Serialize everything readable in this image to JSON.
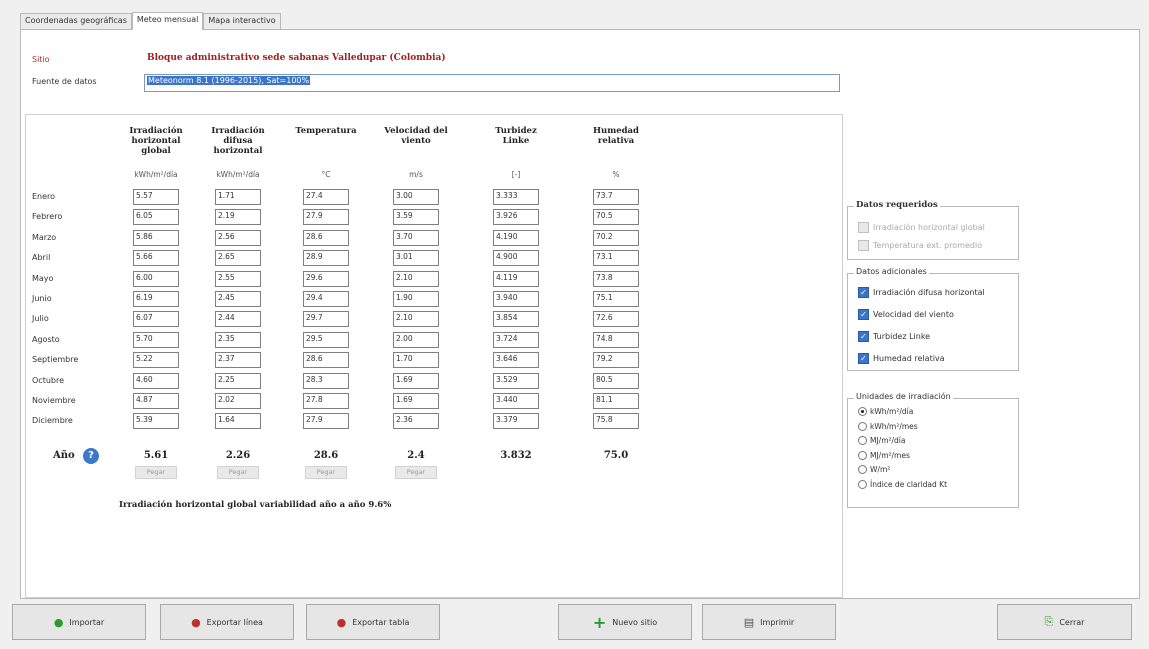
{
  "tabs": [
    "Coordenadas geográficas",
    "Meteo mensual",
    "Mapa interactivo"
  ],
  "site": {
    "label": "Sitio",
    "name": "Bloque administrativo sede sabanas Valledupar   (Colombia)"
  },
  "source": {
    "label": "Fuente de datos",
    "value": "Meteonorm 8.1 (1996-2015), Sat=100%"
  },
  "columns": [
    {
      "title": "Irradiación horizontal global",
      "unit": "kWh/m²/día"
    },
    {
      "title": "Irradiación difusa horizontal",
      "unit": "kWh/m²/día"
    },
    {
      "title": "Temperatura",
      "unit": "°C"
    },
    {
      "title": "Velocidad del viento",
      "unit": "m/s"
    },
    {
      "title": "Turbidez Linke",
      "unit": "[-]"
    },
    {
      "title": "Humedad relativa",
      "unit": "%"
    }
  ],
  "rows": [
    {
      "month": "Enero",
      "values": [
        "5.57",
        "1.71",
        "27.4",
        "3.00",
        "3.333",
        "73.7"
      ]
    },
    {
      "month": "Febrero",
      "values": [
        "6.05",
        "2.19",
        "27.9",
        "3.59",
        "3.926",
        "70.5"
      ]
    },
    {
      "month": "Marzo",
      "values": [
        "5.86",
        "2.56",
        "28.6",
        "3.70",
        "4.190",
        "70.2"
      ]
    },
    {
      "month": "Abril",
      "values": [
        "5.66",
        "2.65",
        "28.9",
        "3.01",
        "4.900",
        "73.1"
      ]
    },
    {
      "month": "Mayo",
      "values": [
        "6.00",
        "2.55",
        "29.6",
        "2.10",
        "4.119",
        "73.8"
      ]
    },
    {
      "month": "Junio",
      "values": [
        "6.19",
        "2.45",
        "29.4",
        "1.90",
        "3.940",
        "75.1"
      ]
    },
    {
      "month": "Julio",
      "values": [
        "6.07",
        "2.44",
        "29.7",
        "2.10",
        "3.854",
        "72.6"
      ]
    },
    {
      "month": "Agosto",
      "values": [
        "5.70",
        "2.35",
        "29.5",
        "2.00",
        "3.724",
        "74.8"
      ]
    },
    {
      "month": "Septiembre",
      "values": [
        "5.22",
        "2.37",
        "28.6",
        "1.70",
        "3.646",
        "79.2"
      ]
    },
    {
      "month": "Octubre",
      "values": [
        "4.60",
        "2.25",
        "28.3",
        "1.69",
        "3.529",
        "80.5"
      ]
    },
    {
      "month": "Noviembre",
      "values": [
        "4.87",
        "2.02",
        "27.8",
        "1.69",
        "3.440",
        "81.1"
      ]
    },
    {
      "month": "Diciembre",
      "values": [
        "5.39",
        "1.64",
        "27.9",
        "2.36",
        "3.379",
        "75.8"
      ]
    }
  ],
  "year": {
    "label": "Año",
    "values": [
      "5.61",
      "2.26",
      "28.6",
      "2.4",
      "3.832",
      "75.0"
    ]
  },
  "paste_label": "Pegar",
  "variability": "Irradiación horizontal global variabilidad año a año  9.6%",
  "required": {
    "title": "Datos requeridos",
    "items": [
      "Irradiación horizontal global",
      "Temperatura ext. promedio"
    ]
  },
  "additional": {
    "title": "Datos adicionales",
    "items": [
      "Irradiación difusa horizontal",
      "Velocidad del viento",
      "Turbidez Linke",
      "Humedad relativa"
    ]
  },
  "units": {
    "title": "Unidades de irradiación",
    "options": [
      "kWh/m²/día",
      "kWh/m²/mes",
      "MJ/m²/día",
      "MJ/m²/mes",
      "W/m²",
      "Índice de claridad Kt"
    ],
    "selected": 0
  },
  "buttons": {
    "import": "Importar",
    "export_line": "Exportar línea",
    "export_table": "Exportar tabla",
    "new_site": "Nuevo sitio",
    "print": "Imprimir",
    "close": "Cerrar"
  },
  "colors": {
    "accent": "#3b74c9",
    "site_name": "#a02020"
  }
}
